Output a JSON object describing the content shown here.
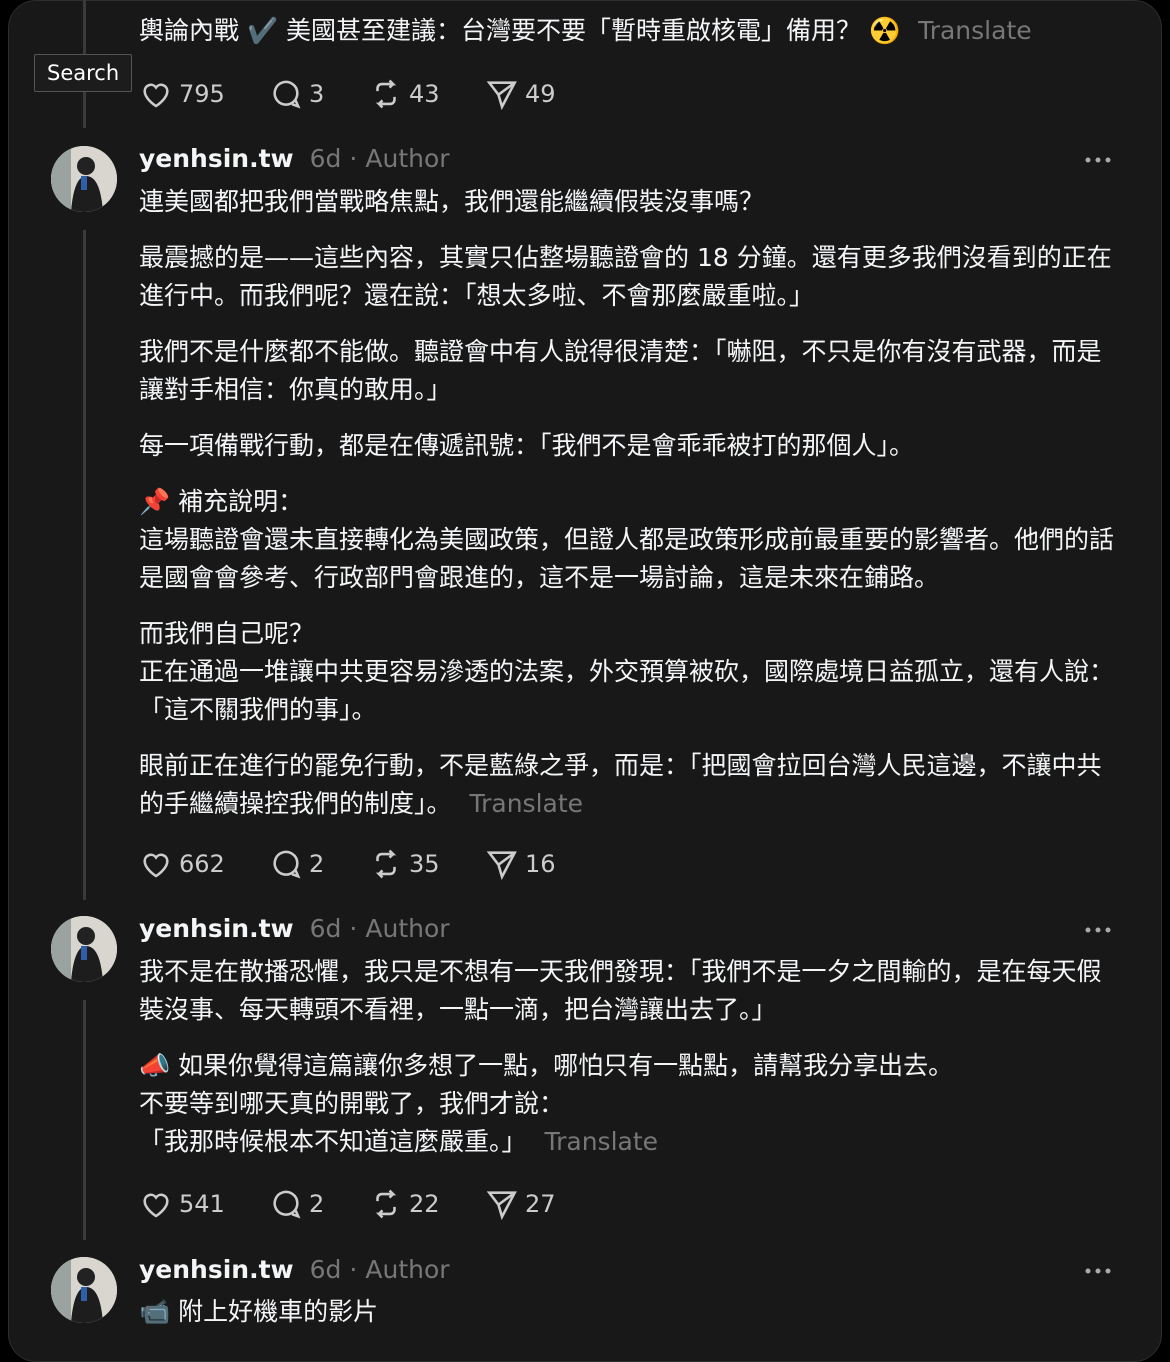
{
  "tooltip": {
    "label": "Search"
  },
  "posts": [
    {
      "text": "輿論內戰 ✔️ 美國甚至建議：台灣要不要「暫時重啟核電」備用？ ☢️",
      "translate": "Translate",
      "likes": "795",
      "replies": "3",
      "reposts": "43",
      "shares": "49"
    },
    {
      "username": "yenhsin.tw",
      "time": "6d",
      "dot": "·",
      "role": "Author",
      "paragraphs": [
        "連美國都把我們當戰略焦點，我們還能繼續假裝沒事嗎？",
        "最震撼的是——這些內容，其實只佔整場聽證會的 18 分鐘。還有更多我們沒看到的正在進行中。而我們呢？還在說：「想太多啦、不會那麼嚴重啦。」",
        "我們不是什麼都不能做。聽證會中有人說得很清楚：「嚇阻，不只是你有沒有武器，而是讓對手相信：你真的敢用。」",
        "每一項備戰行動，都是在傳遞訊號：「我們不是會乖乖被打的那個人」。",
        "📌 補充說明：\n這場聽證會還未直接轉化為美國政策，但證人都是政策形成前最重要的影響者。他們的話是國會會參考、行政部門會跟進的，這不是一場討論，這是未來在鋪路。",
        "而我們自己呢？\n正在通過一堆讓中共更容易滲透的法案，外交預算被砍，國際處境日益孤立，還有人說：「這不關我們的事」。",
        "眼前正在進行的罷免行動，不是藍綠之爭，而是：「把國會拉回台灣人民這邊，不讓中共的手繼續操控我們的制度」。"
      ],
      "translate": "Translate",
      "likes": "662",
      "replies": "2",
      "reposts": "35",
      "shares": "16"
    },
    {
      "username": "yenhsin.tw",
      "time": "6d",
      "dot": "·",
      "role": "Author",
      "paragraphs": [
        "我不是在散播恐懼，我只是不想有一天我們發現：「我們不是一夕之間輸的，是在每天假裝沒事、每天轉頭不看裡，一點一滴，把台灣讓出去了。」",
        "📣 如果你覺得這篇讓你多想了一點，哪怕只有一點點，請幫我分享出去。\n不要等到哪天真的開戰了，我們才說：\n「我那時候根本不知道這麼嚴重。」"
      ],
      "translate": "Translate",
      "likes": "541",
      "replies": "2",
      "reposts": "22",
      "shares": "27"
    },
    {
      "username": "yenhsin.tw",
      "time": "6d",
      "dot": "·",
      "role": "Author",
      "paragraphs": [
        "📹 附上好機車的影片"
      ]
    }
  ],
  "icons": {
    "like": "heart-icon",
    "reply": "comment-icon",
    "repost": "repost-icon",
    "share": "send-icon",
    "more": "more-icon"
  },
  "colors": {
    "background": "#181818",
    "text": "#f3f5f7",
    "muted": "#777777",
    "thread_line": "#3a3a3a"
  }
}
